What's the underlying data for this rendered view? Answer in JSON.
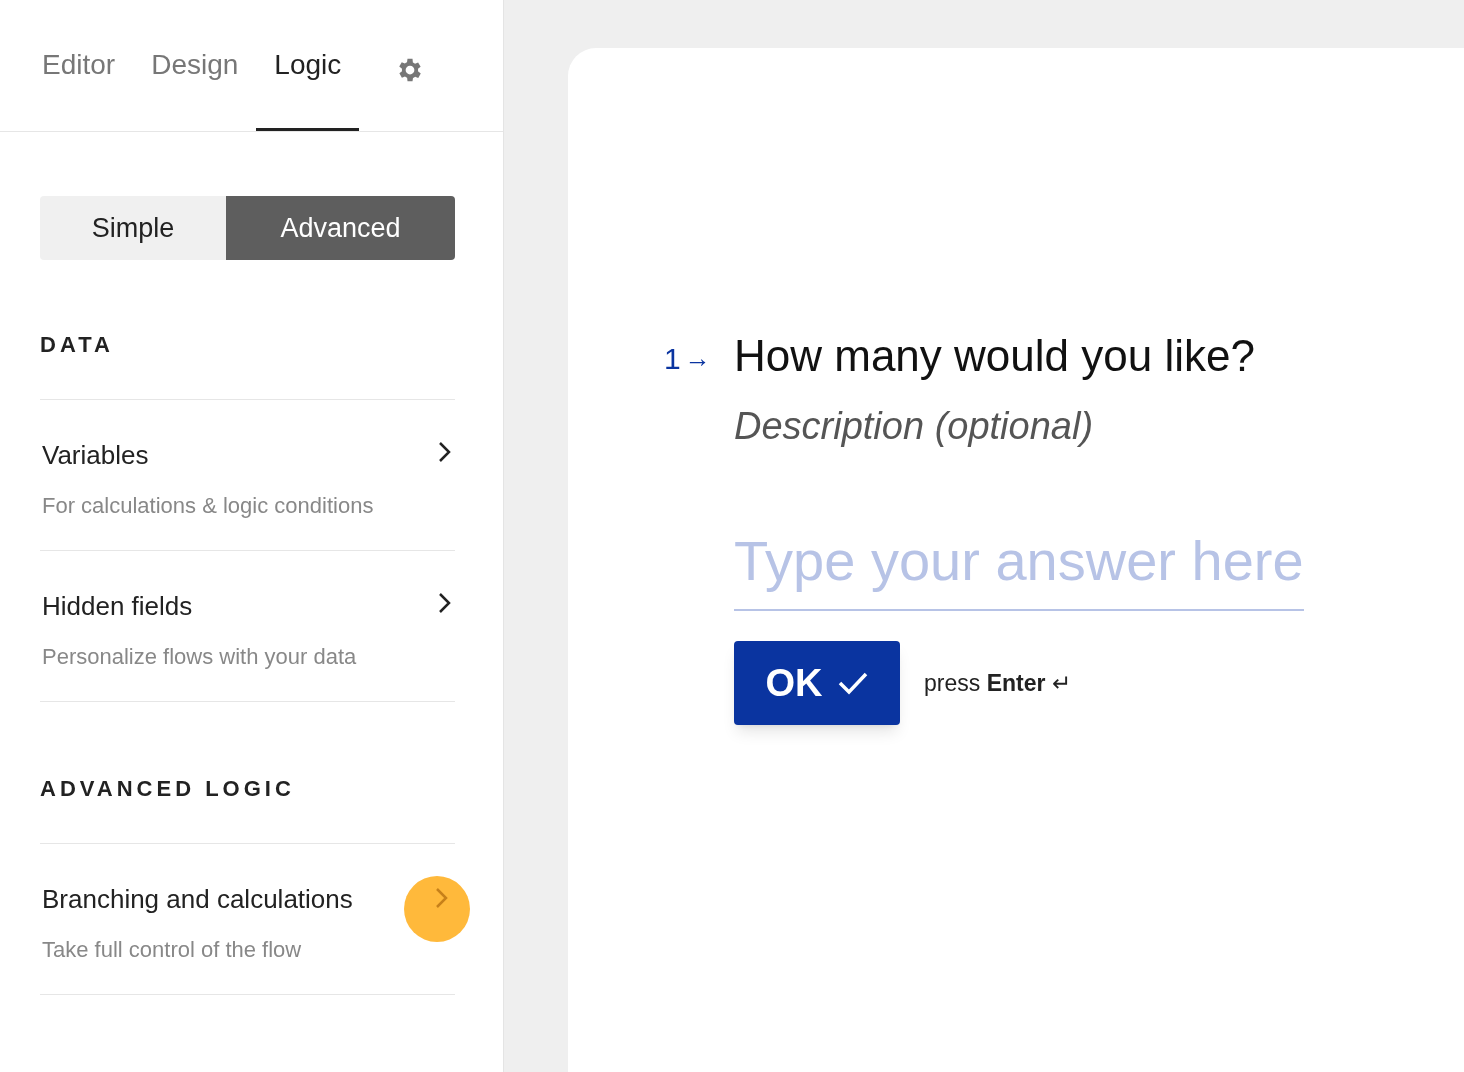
{
  "tabs": [
    {
      "label": "Editor",
      "selected": false
    },
    {
      "label": "Design",
      "selected": false
    },
    {
      "label": "Logic",
      "selected": true
    }
  ],
  "mode_toggle": [
    {
      "label": "Simple",
      "selected": false
    },
    {
      "label": "Advanced",
      "selected": true
    }
  ],
  "sections": [
    {
      "heading": "DATA",
      "items": [
        {
          "title": "Variables",
          "subtitle": "For calculations & logic conditions",
          "highlighted": false
        },
        {
          "title": "Hidden fields",
          "subtitle": "Personalize flows with your data",
          "highlighted": false
        }
      ]
    },
    {
      "heading": "ADVANCED LOGIC",
      "items": [
        {
          "title": "Branching and calculations",
          "subtitle": "Take full control of the flow",
          "highlighted": true
        }
      ]
    }
  ],
  "question": {
    "number": "1",
    "arrow": "→",
    "title": "How many would you like?",
    "description": "Description (optional)",
    "placeholder": "Type your answer here",
    "button": "OK",
    "hint": "press **Enter** ↵"
  }
}
